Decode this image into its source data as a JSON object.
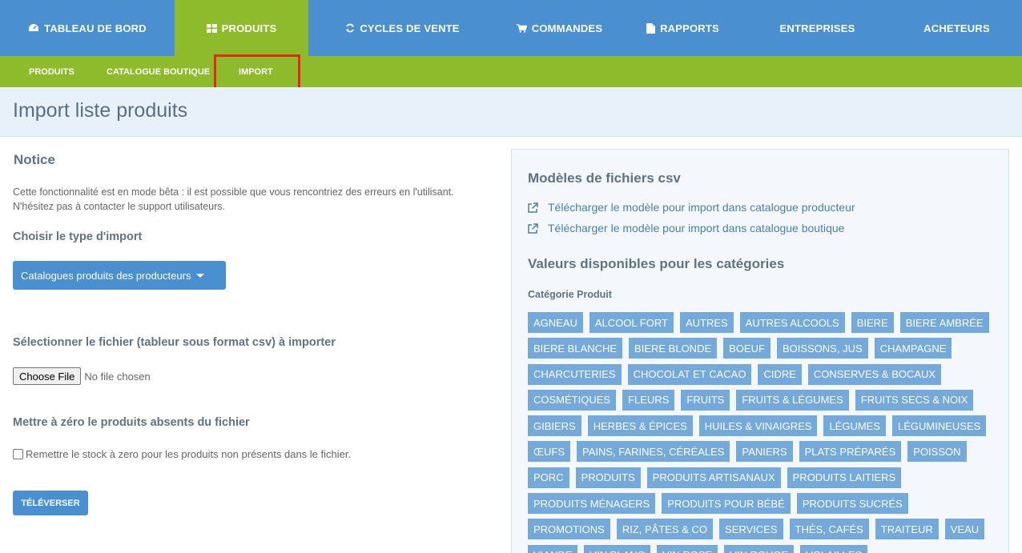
{
  "top_nav": [
    {
      "label": "TABLEAU DE BORD",
      "icon": "dashboard-icon",
      "active": false
    },
    {
      "label": "PRODUITS",
      "icon": "grid-icon",
      "active": true
    },
    {
      "label": "CYCLES DE VENTE",
      "icon": "refresh-icon",
      "active": false
    },
    {
      "label": "COMMANDES",
      "icon": "cart-icon",
      "active": false
    },
    {
      "label": "RAPPORTS",
      "icon": "document-icon",
      "active": false
    },
    {
      "label": "ENTREPRISES",
      "icon": "",
      "active": false
    },
    {
      "label": "ACHETEURS",
      "icon": "",
      "active": false
    }
  ],
  "sub_nav": [
    {
      "label": "PRODUITS"
    },
    {
      "label": "CATALOGUE BOUTIQUE"
    },
    {
      "label": "IMPORT",
      "highlighted": true
    }
  ],
  "page": {
    "title": "Import liste produits"
  },
  "notice": {
    "title": "Notice",
    "line1": "Cette fonctionnalité est en mode bêta : il est possible que vous rencontriez des erreurs en l'utilisant.",
    "line2": "N'hésitez pas à contacter le support utilisateurs."
  },
  "import_type": {
    "label": "Choisir le type d'import",
    "selected": "Catalogues produits des producteurs"
  },
  "file": {
    "label": "Sélectionner le fichier (tableur sous format csv) à importer",
    "button": "Choose File",
    "status": "No file chosen"
  },
  "reset": {
    "label": "Mettre à zéro le produits absents du fichier",
    "checkbox_label": "Remettre le stock à zero pour les produits non présents dans le fichier.",
    "checked": false
  },
  "upload_button": "TÉLÉVERSER",
  "templates": {
    "title": "Modèles de fichiers csv",
    "links": [
      "Télécharger le modèle pour import dans catalogue producteur",
      "Télécharger le modèle pour import dans catalogue boutique"
    ]
  },
  "categories": {
    "title": "Valeurs disponibles pour les catégories",
    "subtitle": "Catégorie Produit",
    "tags": [
      "AGNEAU",
      "ALCOOL FORT",
      "AUTRES",
      "AUTRES ALCOOLS",
      "BIERE",
      "BIERE AMBRÉE",
      "BIERE BLANCHE",
      "BIERE BLONDE",
      "BOEUF",
      "BOISSONS, JUS",
      "CHAMPAGNE",
      "CHARCUTERIES",
      "CHOCOLAT ET CACAO",
      "CIDRE",
      "CONSERVES & BOCAUX",
      "COSMÉTIQUES",
      "FLEURS",
      "FRUITS",
      "FRUITS & LÉGUMES",
      "FRUITS SECS & NOIX",
      "GIBIERS",
      "HERBES & ÉPICES",
      "HUILES & VINAIGRES",
      "LÉGUMES",
      "LÉGUMINEUSES",
      "ŒUFS",
      "PAINS, FARINES, CÉRÉALES",
      "PANIERS",
      "PLATS PRÉPARÉS",
      "POISSON",
      "PORC",
      "PRODUITS",
      "PRODUITS ARTISANAUX",
      "PRODUITS LAITIERS",
      "PRODUITS MÉNAGERS",
      "PRODUITS POUR BÉBÉ",
      "PRODUITS SUCRÉS",
      "PROMOTIONS",
      "RIZ, PÂTES & CO",
      "SERVICES",
      "THÉS, CAFÉS",
      "TRAITEUR",
      "VEAU",
      "VIANDE",
      "VIN BLANC",
      "VIN ROSE",
      "VIN ROUGE",
      "VOLAILLES"
    ]
  },
  "colors": {
    "primary": "#4a8fd0",
    "accent_green": "#8dbb2b",
    "highlight_red": "#e8271b",
    "tag_blue": "#74a9dc"
  }
}
